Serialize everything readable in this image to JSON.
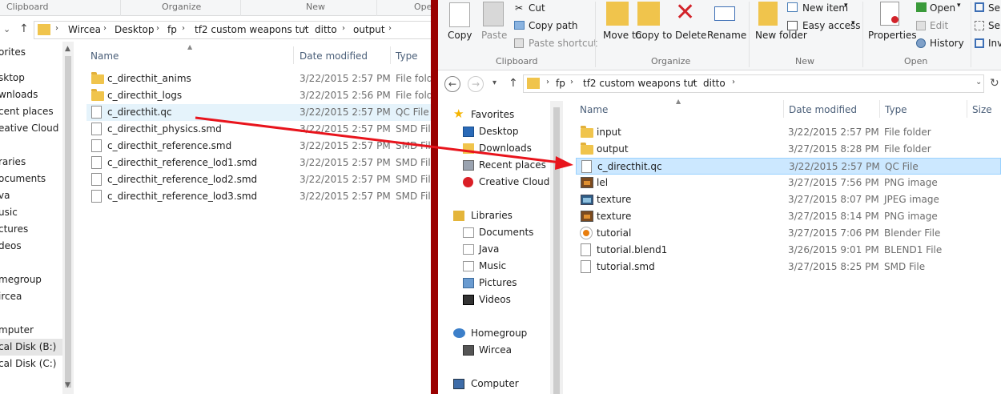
{
  "left_window": {
    "ribbon_groups": [
      "Clipboard",
      "Organize",
      "New",
      "Ope"
    ],
    "breadcrumb": [
      "Wircea",
      "Desktop",
      "fp",
      "tf2 custom weapons tut",
      "ditto",
      "output"
    ],
    "nav": [
      "orites",
      "sktop",
      "wnloads",
      "cent places",
      "eative Cloud Fi",
      "raries",
      "ocuments",
      "va",
      "usic",
      "ctures",
      "deos",
      "megroup",
      "ircea",
      "mputer",
      "cal Disk (B:)",
      "cal Disk (C:)"
    ],
    "columns": {
      "name": "Name",
      "date": "Date modified",
      "type": "Type"
    },
    "files": [
      {
        "name": "c_directhit_anims",
        "date": "3/22/2015 2:57 PM",
        "type": "File folde",
        "icon": "folder-icon"
      },
      {
        "name": "c_directhit_logs",
        "date": "3/22/2015 2:56 PM",
        "type": "File folde",
        "icon": "folder-icon"
      },
      {
        "name": "c_directhit.qc",
        "date": "3/22/2015 2:57 PM",
        "type": "QC File",
        "icon": "file-icon"
      },
      {
        "name": "c_directhit_physics.smd",
        "date": "3/22/2015 2:57 PM",
        "type": "SMD File",
        "icon": "file-icon"
      },
      {
        "name": "c_directhit_reference.smd",
        "date": "3/22/2015 2:57 PM",
        "type": "SMD File",
        "icon": "file-icon"
      },
      {
        "name": "c_directhit_reference_lod1.smd",
        "date": "3/22/2015 2:57 PM",
        "type": "SMD File",
        "icon": "file-icon"
      },
      {
        "name": "c_directhit_reference_lod2.smd",
        "date": "3/22/2015 2:57 PM",
        "type": "SMD File",
        "icon": "file-icon"
      },
      {
        "name": "c_directhit_reference_lod3.smd",
        "date": "3/22/2015 2:57 PM",
        "type": "SMD File",
        "icon": "file-icon"
      }
    ]
  },
  "right_window": {
    "ribbon": {
      "copy": "Copy",
      "paste": "Paste",
      "cut": "Cut",
      "copy_path": "Copy path",
      "paste_shortcut": "Paste shortcut",
      "move_to": "Move to",
      "copy_to": "Copy to",
      "delete": "Delete",
      "rename": "Rename",
      "new_folder": "New folder",
      "new_item": "New item",
      "easy_access": "Easy access",
      "properties": "Properties",
      "open": "Open",
      "edit": "Edit",
      "history": "History",
      "cut_se1": "Se",
      "cut_se2": "Se",
      "cut_inv": "Inv",
      "groups": [
        "Clipboard",
        "Organize",
        "New",
        "Open"
      ]
    },
    "breadcrumb": [
      "fp",
      "tf2 custom weapons tut",
      "ditto"
    ],
    "nav": {
      "favorites": "Favorites",
      "desktop": "Desktop",
      "downloads": "Downloads",
      "recent": "Recent places",
      "creative": "Creative Cloud Fi",
      "libraries": "Libraries",
      "documents": "Documents",
      "java": "Java",
      "music": "Music",
      "pictures": "Pictures",
      "videos": "Videos",
      "homegroup": "Homegroup",
      "user": "Wircea",
      "computer": "Computer"
    },
    "columns": {
      "name": "Name",
      "date": "Date modified",
      "type": "Type",
      "size": "Size"
    },
    "files": [
      {
        "name": "input",
        "date": "3/22/2015 2:57 PM",
        "type": "File folder",
        "icon": "folder-icon"
      },
      {
        "name": "output",
        "date": "3/27/2015 8:28 PM",
        "type": "File folder",
        "icon": "folder-icon"
      },
      {
        "name": "c_directhit.qc",
        "date": "3/22/2015 2:57 PM",
        "type": "QC File",
        "icon": "file-icon"
      },
      {
        "name": "lel",
        "date": "3/27/2015 7:56 PM",
        "type": "PNG image",
        "icon": "png-icon"
      },
      {
        "name": "texture",
        "date": "3/27/2015 8:07 PM",
        "type": "JPEG image",
        "icon": "jpeg-icon"
      },
      {
        "name": "texture",
        "date": "3/27/2015 8:14 PM",
        "type": "PNG image",
        "icon": "png-icon"
      },
      {
        "name": "tutorial",
        "date": "3/27/2015 7:06 PM",
        "type": "Blender File",
        "icon": "blender-icon"
      },
      {
        "name": "tutorial.blend1",
        "date": "3/26/2015 9:01 PM",
        "type": "BLEND1 File",
        "icon": "file-icon"
      },
      {
        "name": "tutorial.smd",
        "date": "3/27/2015 8:25 PM",
        "type": "SMD File",
        "icon": "file-icon"
      }
    ]
  },
  "colors": {
    "divider": "#9a0000",
    "arrow": "#e8141c",
    "selection": "#cce8ff",
    "hover": "#e5f3fb"
  }
}
